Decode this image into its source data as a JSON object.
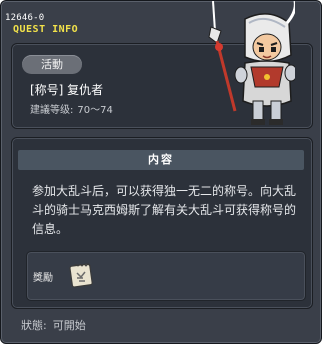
{
  "header": {
    "quest_id": "12646-0",
    "title": "QUEST INFO"
  },
  "quest": {
    "badge": "活動",
    "name": "[称号] 复仇者",
    "level_label": "建議等级:",
    "level_range": "70～74"
  },
  "content": {
    "header": "内容",
    "description": "参加大乱斗后，可以获得独一无二的称号。向大乱斗的骑士马克西姆斯了解有关大乱斗可获得称号的信息。"
  },
  "reward": {
    "label": "獎勵",
    "item_icon": "scroll-icon"
  },
  "status": {
    "label": "狀態:",
    "value": "可開始"
  },
  "colors": {
    "title_yellow": "#f2e24a",
    "window_bg": "#3a3f49",
    "panel_bg": "#2c313a",
    "content_header_bg": "#4a5561"
  },
  "icons": {
    "npc": "npc-knight-portrait"
  }
}
